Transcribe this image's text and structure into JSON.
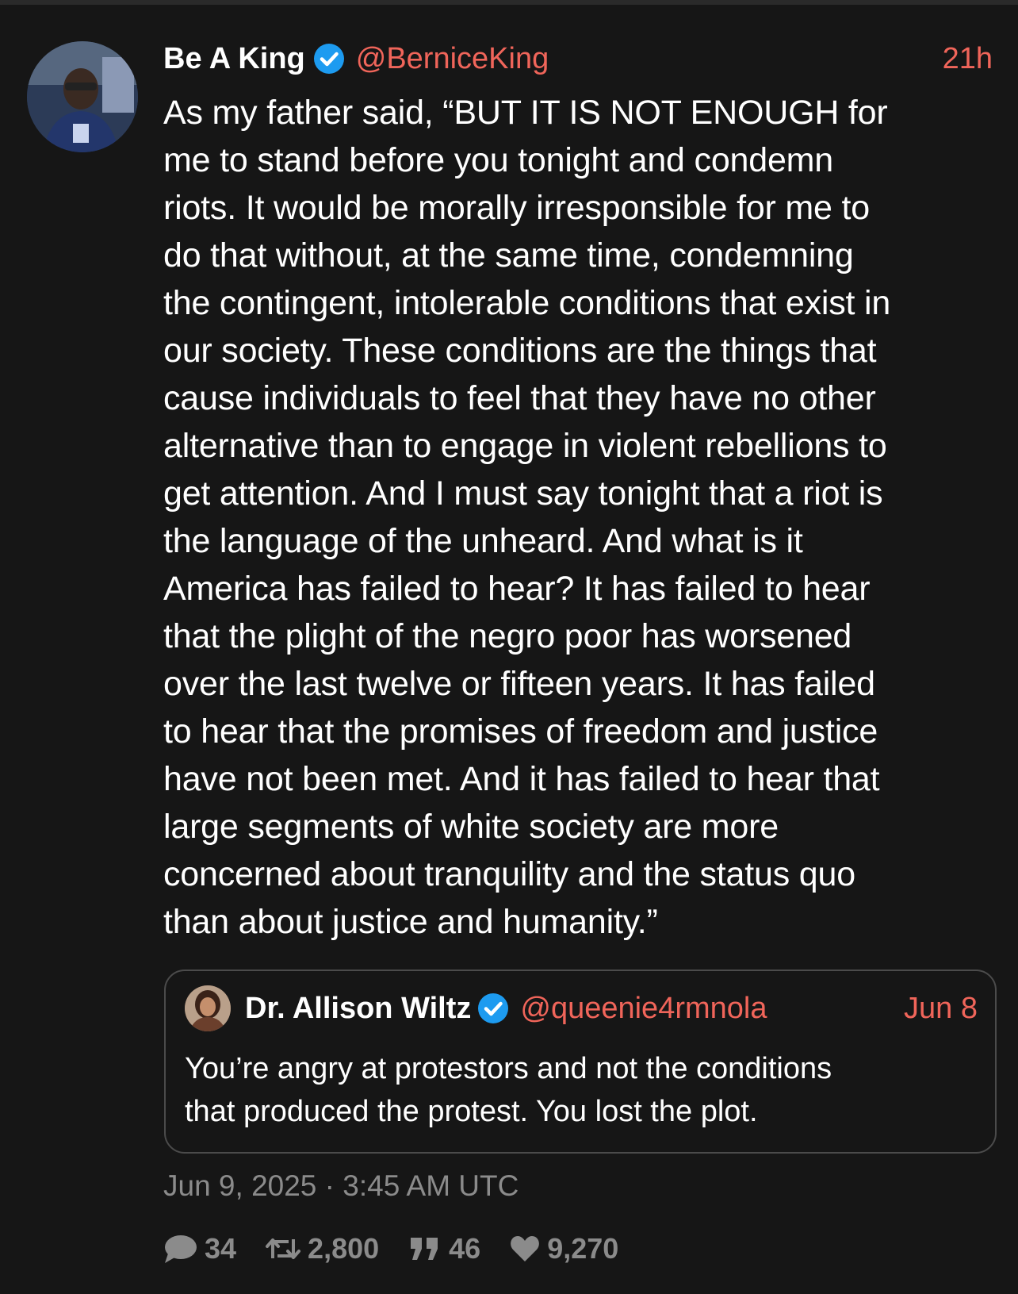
{
  "tweet": {
    "display_name": "Be A King",
    "handle": "@BerniceKing",
    "time_ago": "21h",
    "text": "As my father said, “BUT IT IS NOT ENOUGH for\nme to stand before you tonight and condemn\nriots. It would be morally irresponsible for me to\ndo that without, at the same time, condemning\nthe contingent, intolerable conditions that exist in\nour society. These conditions are the things that\ncause individuals to feel that they have no other\nalternative than to engage in violent rebellions to\nget attention. And I must say tonight that a riot is\nthe language of the unheard. And what is it\nAmerica has failed to hear? It has failed to hear\nthat the plight of the negro poor has worsened\nover the last twelve or fifteen years. It has failed\nto hear that the promises of freedom and justice\nhave not been met. And it has failed to hear that\nlarge segments of white society are more\nconcerned about tranquility and the status quo\nthan about justice and humanity.”",
    "full_date": "Jun 9, 2025 · 3:45 AM UTC",
    "stats": {
      "replies": "34",
      "retweets": "2,800",
      "quotes": "46",
      "likes": "9,270"
    }
  },
  "quoted_tweet": {
    "display_name": "Dr. Allison Wiltz",
    "handle": "@queenie4rmnola",
    "date": "Jun 8",
    "text": "You’re angry at protestors and not the conditions\nthat produced the protest. You lost the plot."
  },
  "colors": {
    "background": "#161616",
    "accent": "#f0655a",
    "verified": "#1d9bf0",
    "muted": "#8b8b8b",
    "border": "#4b4b4b"
  },
  "icons": {
    "verified": "verified-badge-icon",
    "reply": "speech-bubble-icon",
    "retweet": "retweet-arrows-icon",
    "quote": "quote-marks-icon",
    "like": "heart-icon"
  }
}
